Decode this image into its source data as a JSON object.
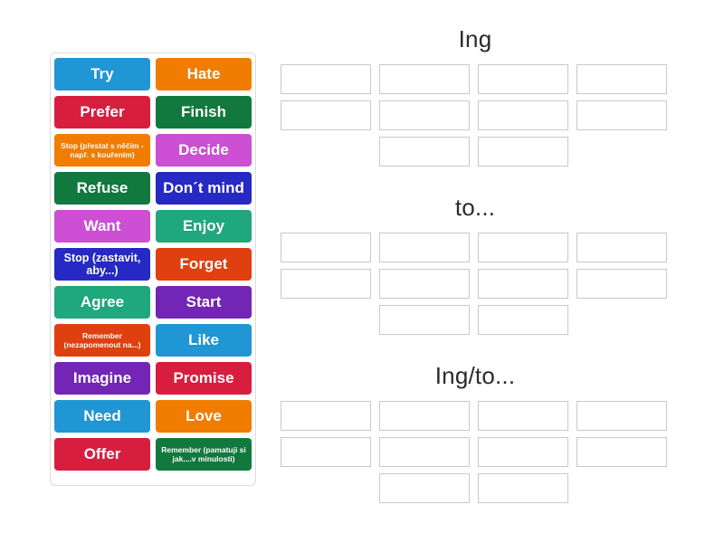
{
  "tiles": [
    {
      "label": "Try",
      "color": "#2196d4",
      "size": "big"
    },
    {
      "label": "Hate",
      "color": "#f07d00",
      "size": "big"
    },
    {
      "label": "Prefer",
      "color": "#d81e3f",
      "size": "big"
    },
    {
      "label": "Finish",
      "color": "#12793e",
      "size": "big"
    },
    {
      "label": "Stop (přestat s něčím - např. s kouřením)",
      "color": "#f07d00",
      "size": "small"
    },
    {
      "label": "Decide",
      "color": "#cc4fd4",
      "size": "big"
    },
    {
      "label": "Refuse",
      "color": "#12793e",
      "size": "big"
    },
    {
      "label": "Don´t mind",
      "color": "#2629c4",
      "size": "big"
    },
    {
      "label": "Want",
      "color": "#cc4fd4",
      "size": "big"
    },
    {
      "label": "Enjoy",
      "color": "#1fa87b",
      "size": "big"
    },
    {
      "label": "Stop (zastavit, aby...)",
      "color": "#2629c4",
      "size": "mid"
    },
    {
      "label": "Forget",
      "color": "#e0400f",
      "size": "big"
    },
    {
      "label": "Agree",
      "color": "#1fa87b",
      "size": "big"
    },
    {
      "label": "Start",
      "color": "#7325b5",
      "size": "big"
    },
    {
      "label": "Remember (nezapomenout na...)",
      "color": "#e0400f",
      "size": "small"
    },
    {
      "label": "Like",
      "color": "#2196d4",
      "size": "big"
    },
    {
      "label": "Imagine",
      "color": "#7325b5",
      "size": "big"
    },
    {
      "label": "Promise",
      "color": "#d81e3f",
      "size": "big"
    },
    {
      "label": "Need",
      "color": "#2196d4",
      "size": "big"
    },
    {
      "label": "Love",
      "color": "#f07d00",
      "size": "big"
    },
    {
      "label": "Offer",
      "color": "#d81e3f",
      "size": "big"
    },
    {
      "label": "Remember (pamatuji si jak....v minulosti)",
      "color": "#12793e",
      "size": "small"
    }
  ],
  "groups": [
    {
      "title": "Ing",
      "slots_rows": [
        4,
        4
      ],
      "slots_last_row": 2,
      "filled": []
    },
    {
      "title": "to...",
      "slots_rows": [
        4,
        4
      ],
      "slots_last_row": 2,
      "filled": []
    },
    {
      "title": "Ing/to...",
      "slots_rows": [
        4,
        4
      ],
      "slots_last_row": 2,
      "filled": []
    }
  ],
  "colors": {
    "page_background": "#ffffff",
    "panel_border": "#dcdcdc",
    "drop_box_border": "#c9c9c9",
    "title_text": "#2b2b2b",
    "tile_text": "#ffffff"
  }
}
